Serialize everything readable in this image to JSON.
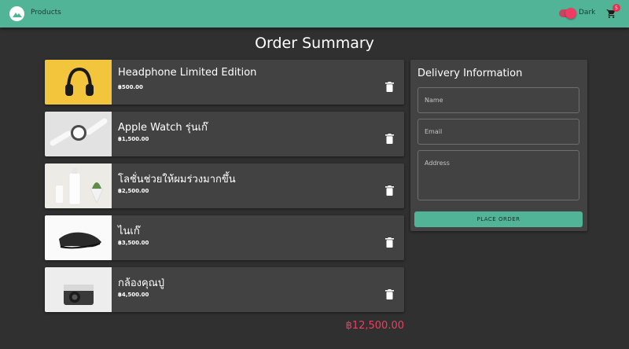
{
  "appbar": {
    "nav_label": "Products",
    "theme_label": "Dark",
    "cart_count": "5",
    "accent_color": "#52b497"
  },
  "page": {
    "title": "Order Summary"
  },
  "order": {
    "items": [
      {
        "name": "Headphone Limited Edition",
        "price": "฿500.00",
        "thumbnail": "yellow-headphones"
      },
      {
        "name": "Apple Watch รุ่นเก๊",
        "price": "฿1,500.00",
        "thumbnail": "white-smartwatch"
      },
      {
        "name": "โลชั่นช่วยให้ผมร่วงมากขึ้น",
        "price": "฿2,500.00",
        "thumbnail": "cosmetic-bottles"
      },
      {
        "name": "ไนเก๊",
        "price": "฿3,500.00",
        "thumbnail": "black-sneaker"
      },
      {
        "name": "กล้องคุณปู่",
        "price": "฿4,500.00",
        "thumbnail": "instant-camera"
      }
    ],
    "total": "฿12,500.00",
    "total_color": "#e8405f"
  },
  "delivery": {
    "title": "Delivery Information",
    "name_placeholder": "Name",
    "email_placeholder": "Email",
    "address_placeholder": "Address",
    "submit_label": "PLACE ORDER"
  }
}
